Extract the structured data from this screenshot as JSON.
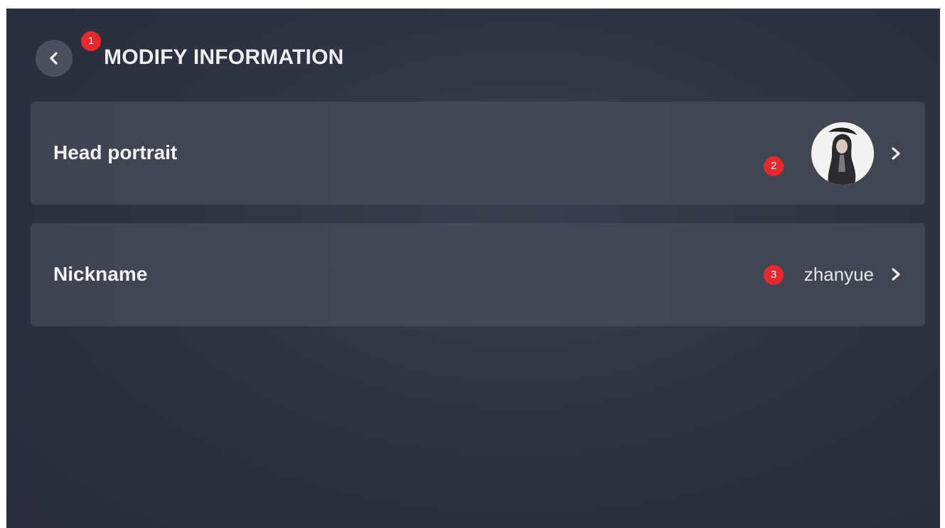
{
  "header": {
    "title": "MODIFY INFORMATION",
    "back_icon": "chevron-left-icon",
    "marker": "1"
  },
  "rows": {
    "portrait": {
      "label": "Head portrait",
      "marker": "2",
      "avatar": "user-avatar",
      "chevron_icon": "chevron-right-icon"
    },
    "nickname": {
      "label": "Nickname",
      "value": "zhanyue",
      "marker": "3",
      "chevron_icon": "chevron-right-icon"
    }
  },
  "colors": {
    "background": "#2f3342",
    "card": "#424754",
    "marker": "#e8282b",
    "text": "#f2f3f6"
  }
}
